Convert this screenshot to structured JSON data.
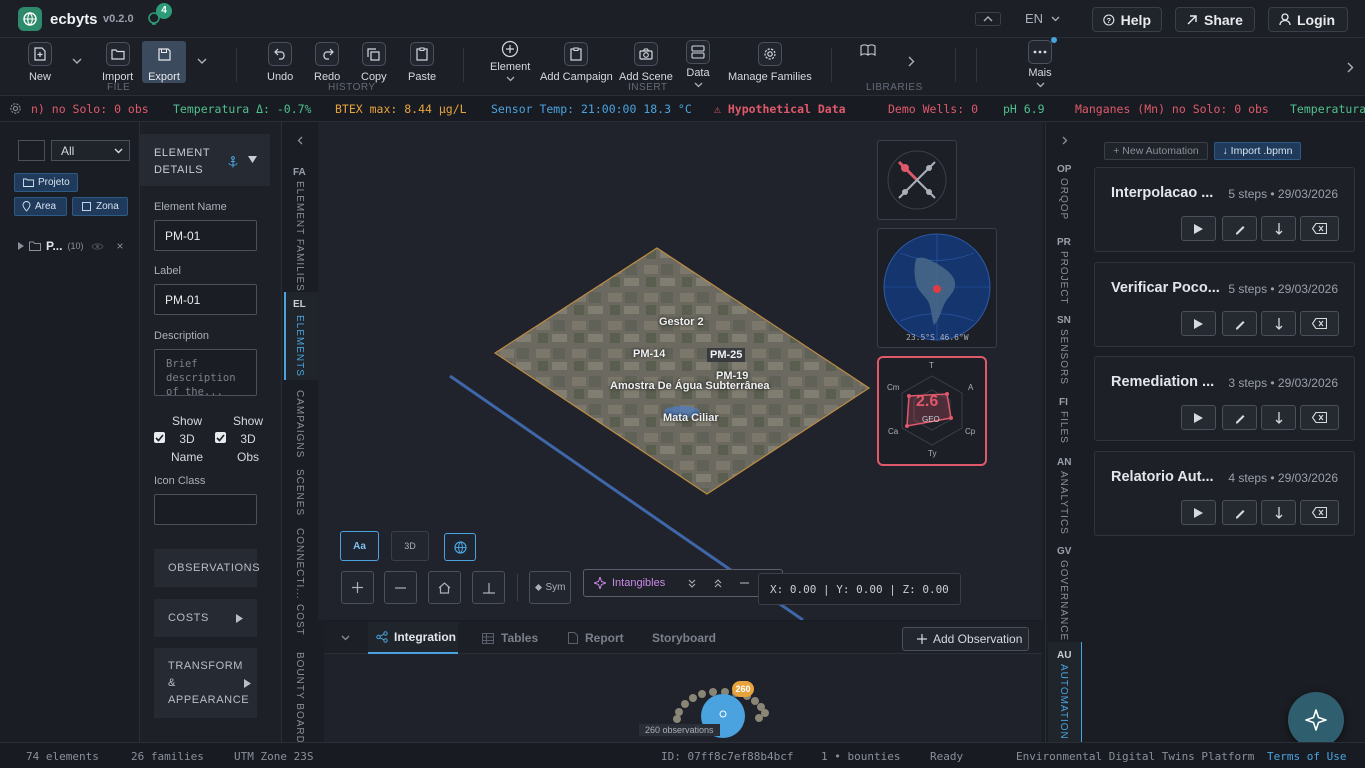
{
  "app": {
    "name": "ecbyts",
    "version": "v0.2.0",
    "notif_count": "4"
  },
  "header": {
    "lang": "EN",
    "help": "Help",
    "share": "Share",
    "login": "Login"
  },
  "toolbar": {
    "new": "New",
    "import": "Import",
    "export": "Export",
    "file_group": "FILE",
    "undo": "Undo",
    "redo": "Redo",
    "copy": "Copy",
    "paste": "Paste",
    "history_group": "HISTORY",
    "element": "Element",
    "add_campaign": "Add Campaign",
    "add_scene": "Add Scene",
    "data": "Data",
    "manage_families": "Manage Families",
    "insert_group": "INSERT",
    "libraries_group": "LIBRARIES",
    "mais": "Mais"
  },
  "ticker": [
    {
      "text": "n) no Solo: 0 obs",
      "color": "#e0596b"
    },
    {
      "text": "Temperatura Δ: -0.7%",
      "color": "#4fc08d"
    },
    {
      "text": "BTEX max: 8.44 µg/L",
      "color": "#e8a33d"
    },
    {
      "text": "Sensor Temp: 21:00:00 18.3 °C",
      "color": "#4aa3df"
    },
    {
      "text": "⚠ Hypothetical Data",
      "color": "#e0596b"
    },
    {
      "text": "Demo Wells: 0",
      "color": "#e0596b"
    },
    {
      "text": "pH 6.9",
      "color": "#4fc08d"
    },
    {
      "text": "Manganes (Mn) no Solo: 0 obs",
      "color": "#e0596b"
    },
    {
      "text": "Temperatura",
      "color": "#4fc08d"
    }
  ],
  "left": {
    "filter": "All",
    "projeto": "Projeto",
    "area": "Area",
    "zona": "Zona",
    "tree_item": "P...",
    "tree_count": "(10)"
  },
  "details": {
    "title": "ELEMENT DETAILS",
    "name_label": "Element Name",
    "name_value": "PM-01",
    "label_label": "Label",
    "label_value": "PM-01",
    "desc_label": "Description",
    "desc_placeholder": "Brief description of the...",
    "show3dname": "Show 3D Name",
    "show3dobs": "Show 3D Obs",
    "icon_class": "Icon Class",
    "observations": "OBSERVATIONS",
    "costs": "COSTS",
    "transform": "TRANSFORM & APPEARANCE"
  },
  "lefttabs": [
    {
      "code": "FA",
      "label": "ELEMENT FAMILIES"
    },
    {
      "code": "EL",
      "label": "ELEMENTS"
    },
    {
      "code": "",
      "label": "CAMPAIGNS"
    },
    {
      "code": "",
      "label": "SCENES"
    },
    {
      "code": "",
      "label": "CONNECTI..."
    },
    {
      "code": "",
      "label": "COST"
    },
    {
      "code": "",
      "label": "BOUNTY BOARD"
    }
  ],
  "scene": {
    "labels": [
      "Gestor 2",
      "PM-14",
      "PM-25",
      "PM-19",
      "Amostra De Água Subterrânea",
      "Mata Ciliar"
    ],
    "globe_coords": "23.5°S 46.6°W",
    "radar_axes": [
      "T",
      "A",
      "Cp",
      "Ty",
      "Ca",
      "Cm"
    ],
    "radar_value": "2.6",
    "radar_label": "GEO",
    "btn_aa": "Aa",
    "btn_3d": "3D",
    "sym": "Sym",
    "intangibles": "Intangibles",
    "coords": "X: 0.00 | Y: 0.00 | Z: 0.00"
  },
  "bottom": {
    "tabs": [
      "Integration",
      "Tables",
      "Report",
      "Storyboard"
    ],
    "add_obs": "Add Observation",
    "badge": "260",
    "obs_label": "260 observations"
  },
  "righttabs": [
    {
      "code": "OP",
      "label": "ORQOP"
    },
    {
      "code": "PR",
      "label": "PROJECT"
    },
    {
      "code": "SN",
      "label": "SENSORS"
    },
    {
      "code": "FI",
      "label": "FILES"
    },
    {
      "code": "AN",
      "label": "ANALYTICS"
    },
    {
      "code": "GV",
      "label": "GOVERNANCE"
    },
    {
      "code": "AU",
      "label": "AUTOMATION"
    }
  ],
  "automation": {
    "new_btn": "+ New Automation",
    "import_btn": "↓ Import .bpmn",
    "cards": [
      {
        "title": "Interpolacao ...",
        "meta": "5 steps • 29/03/2026"
      },
      {
        "title": "Verificar Poco...",
        "meta": "5 steps • 29/03/2026"
      },
      {
        "title": "Remediation ...",
        "meta": "3 steps • 29/03/2026"
      },
      {
        "title": "Relatorio Aut...",
        "meta": "4 steps • 29/03/2026"
      }
    ]
  },
  "status": {
    "elements": "74 elements",
    "families": "26 families",
    "utm": "UTM Zone 23S",
    "id": "ID: 07ff8c7ef88b4bcf",
    "bounties": "1 • bounties",
    "ready": "Ready",
    "platform": "Environmental Digital Twins Platform",
    "terms": "Terms of Use"
  },
  "colors": {
    "accent": "#4aa3df",
    "export_bg": "#3b4a5c",
    "danger": "#e0596b",
    "success": "#4fc08d",
    "warning": "#e8a33d"
  }
}
